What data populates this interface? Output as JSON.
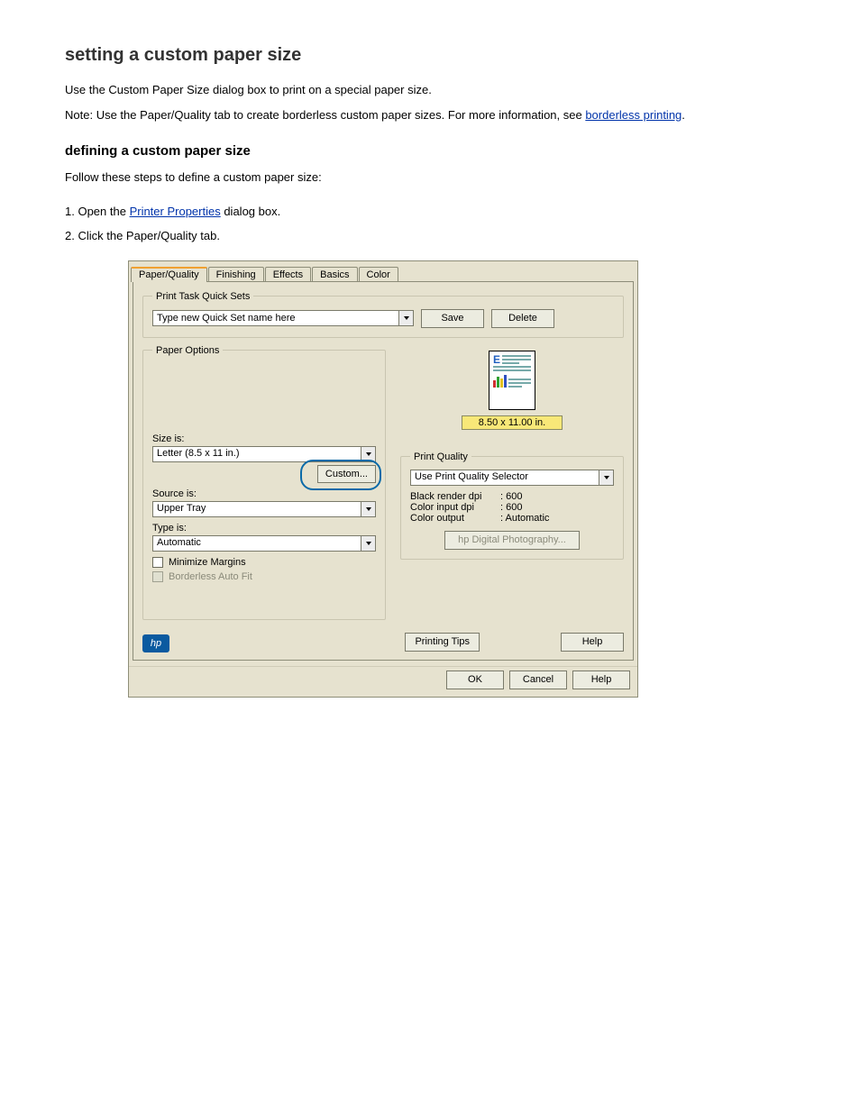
{
  "doc": {
    "heading": "setting a custom paper size",
    "intro": "Use the Custom Paper Size dialog box to print on a special paper size.",
    "note_label": "Note:",
    "note_text": " Use the Paper/Quality tab to create borderless custom paper sizes. For more information, see ",
    "note_link": "borderless printing",
    "note_after": ".",
    "heading2": "defining a custom paper size",
    "steps_intro": "Follow these steps to define a custom paper size:",
    "step1": "1. Open the ",
    "step1_link": "Printer Properties",
    "step1_after": " dialog box.",
    "step2": "2. Click the Paper/Quality tab."
  },
  "tabs": [
    "Paper/Quality",
    "Finishing",
    "Effects",
    "Basics",
    "Color"
  ],
  "quickset": {
    "legend": "Print Task Quick Sets",
    "placeholder": "Type new Quick Set name here",
    "save": "Save",
    "delete": "Delete"
  },
  "paper": {
    "legend": "Paper Options",
    "size_label": "Size is:",
    "size_value": "Letter (8.5 x 11 in.)",
    "custom": "Custom...",
    "source_label": "Source is:",
    "source_value": "Upper Tray",
    "type_label": "Type is:",
    "type_value": "Automatic",
    "minimize_margins": "Minimize Margins",
    "borderless": "Borderless Auto Fit"
  },
  "preview": {
    "size_text": "8.50 x 11.00 in."
  },
  "quality": {
    "legend": "Print Quality",
    "selector": "Use Print Quality Selector",
    "black_label": "Black render dpi",
    "black_val": ": 600",
    "colorin_label": "Color input dpi",
    "colorin_val": ": 600",
    "colorout_label": "Color output",
    "colorout_val": ": Automatic",
    "digital_photo": "hp Digital Photography..."
  },
  "bottom": {
    "printing_tips": "Printing Tips",
    "help": "Help"
  },
  "dialog_buttons": {
    "ok": "OK",
    "cancel": "Cancel",
    "help": "Help"
  },
  "logo": "hp"
}
